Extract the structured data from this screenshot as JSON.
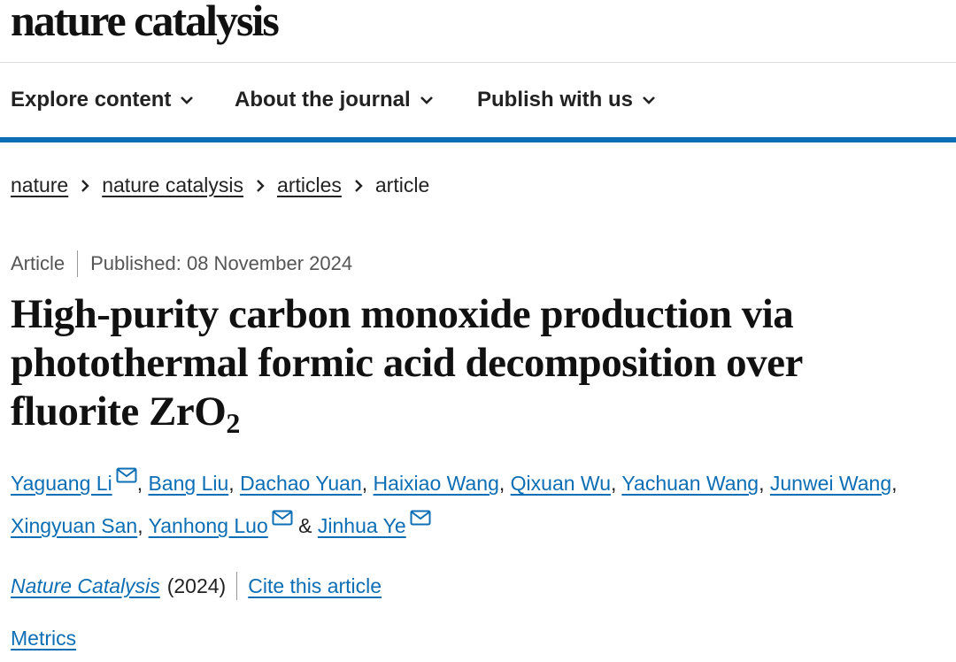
{
  "header": {
    "logo": "nature catalysis"
  },
  "nav": {
    "items": [
      {
        "label": "Explore content"
      },
      {
        "label": "About the journal"
      },
      {
        "label": "Publish with us"
      }
    ],
    "accent_color": "#0c6eb4"
  },
  "breadcrumb": {
    "items": [
      {
        "label": "nature"
      },
      {
        "label": "nature catalysis"
      },
      {
        "label": "articles"
      }
    ],
    "current": "article"
  },
  "article": {
    "type": "Article",
    "published": "Published: 08 November 2024",
    "title_main": "High-purity carbon monoxide production via photothermal formic acid decomposition over fluorite ZrO",
    "title_subscript": "2",
    "authors": [
      {
        "name": "Yaguang Li",
        "has_email": true,
        "sep": ", "
      },
      {
        "name": "Bang Liu",
        "has_email": false,
        "sep": ", "
      },
      {
        "name": "Dachao Yuan",
        "has_email": false,
        "sep": ", "
      },
      {
        "name": "Haixiao Wang",
        "has_email": false,
        "sep": ", "
      },
      {
        "name": "Qixuan Wu",
        "has_email": false,
        "sep": ", "
      },
      {
        "name": "Yachuan Wang",
        "has_email": false,
        "sep": ", "
      },
      {
        "name": "Junwei Wang",
        "has_email": false,
        "sep": ", "
      },
      {
        "name": "Xingyuan San",
        "has_email": false,
        "sep": ", "
      },
      {
        "name": "Yanhong Luo",
        "has_email": true,
        "sep": " & "
      },
      {
        "name": "Jinhua Ye",
        "has_email": true,
        "sep": ""
      }
    ],
    "journal": "Nature Catalysis",
    "year": "(2024)",
    "cite_label": "Cite this article",
    "metrics_label": "Metrics",
    "link_color": "#0c6eb4"
  },
  "icons": {
    "chevron": "chevron-down-icon",
    "breadcrumb_sep": "chevron-right-icon",
    "email": "email-icon"
  }
}
